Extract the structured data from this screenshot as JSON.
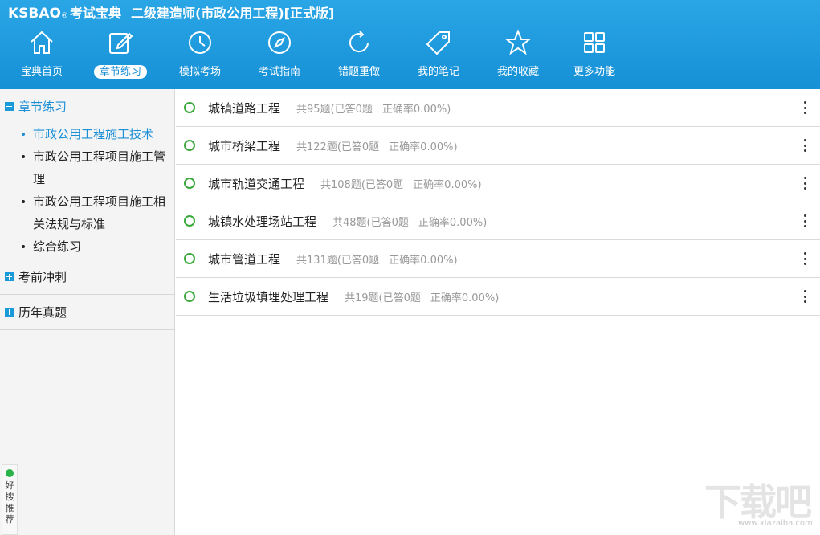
{
  "header": {
    "brand": "KSBAO",
    "brand_mark": "®",
    "brand_cn": "考试宝典",
    "title": "二级建造师(市政公用工程)[正式版]"
  },
  "nav": [
    {
      "label": "宝典首页",
      "icon": "home-icon"
    },
    {
      "label": "章节练习",
      "icon": "edit-icon",
      "active": true
    },
    {
      "label": "模拟考场",
      "icon": "clock-icon"
    },
    {
      "label": "考试指南",
      "icon": "compass-icon"
    },
    {
      "label": "错题重做",
      "icon": "refresh-icon"
    },
    {
      "label": "我的笔记",
      "icon": "tag-icon"
    },
    {
      "label": "我的收藏",
      "icon": "star-icon"
    },
    {
      "label": "更多功能",
      "icon": "grid-icon"
    }
  ],
  "sidebar": {
    "sections": [
      {
        "title": "章节练习",
        "expanded": true,
        "items": [
          {
            "label": "市政公用工程施工技术",
            "active": true
          },
          {
            "label": "市政公用工程项目施工管理"
          },
          {
            "label": "市政公用工程项目施工相关法规与标准"
          },
          {
            "label": "综合练习"
          }
        ]
      },
      {
        "title": "考前冲刺",
        "expanded": false
      },
      {
        "title": "历年真题",
        "expanded": false
      }
    ],
    "widget": {
      "label": "好搜推荐"
    }
  },
  "chapters": [
    {
      "title": "城镇道路工程",
      "count": "共95题(已答0题",
      "rate": "正确率0.00%)"
    },
    {
      "title": "城市桥梁工程",
      "count": "共122题(已答0题",
      "rate": "正确率0.00%)"
    },
    {
      "title": "城市轨道交通工程",
      "count": "共108题(已答0题",
      "rate": "正确率0.00%)"
    },
    {
      "title": "城镇水处理场站工程",
      "count": "共48题(已答0题",
      "rate": "正确率0.00%)"
    },
    {
      "title": "城市管道工程",
      "count": "共131题(已答0题",
      "rate": "正确率0.00%)"
    },
    {
      "title": "生活垃圾填埋处理工程",
      "count": "共19题(已答0题",
      "rate": "正确率0.00%)"
    }
  ],
  "watermark": {
    "big": "下载吧",
    "small": "www.xiazaiba.com"
  },
  "colors": {
    "header": "#1a9ad9",
    "accent": "#1a8fd6",
    "circle": "#3aa83a"
  }
}
